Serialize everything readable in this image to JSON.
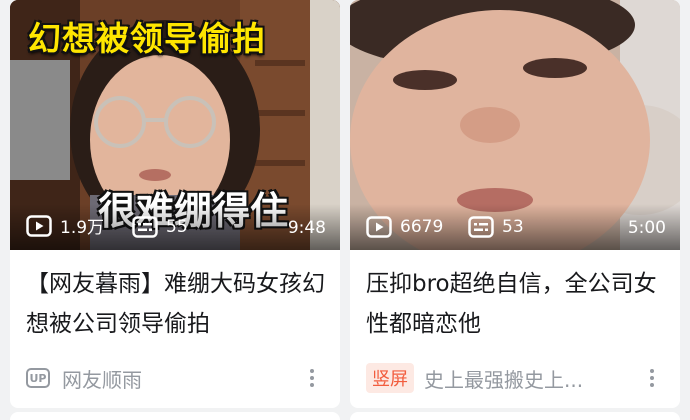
{
  "cards": [
    {
      "overlay_top": "幻想被领导偷拍",
      "overlay_mid": "很难绷得住",
      "plays": "1.9万",
      "danmaku": "55",
      "duration": "9:48",
      "title": "【网友暮雨】难绷大码女孩幻想被公司领导偷拍",
      "up_badge": "UP",
      "author": "网友顺雨"
    },
    {
      "plays": "6679",
      "danmaku": "53",
      "duration": "5:00",
      "title": "压抑bro超绝自信，全公司女性都暗恋他",
      "tag": "竖屏",
      "author": "史上最强搬史上..."
    }
  ],
  "colors": {
    "accent": "#f25d3e",
    "meta_gray": "#9499a0",
    "title": "#18191c"
  },
  "icons": [
    "play-count-icon",
    "danmaku-count-icon",
    "up-badge-icon",
    "more-options-icon"
  ]
}
